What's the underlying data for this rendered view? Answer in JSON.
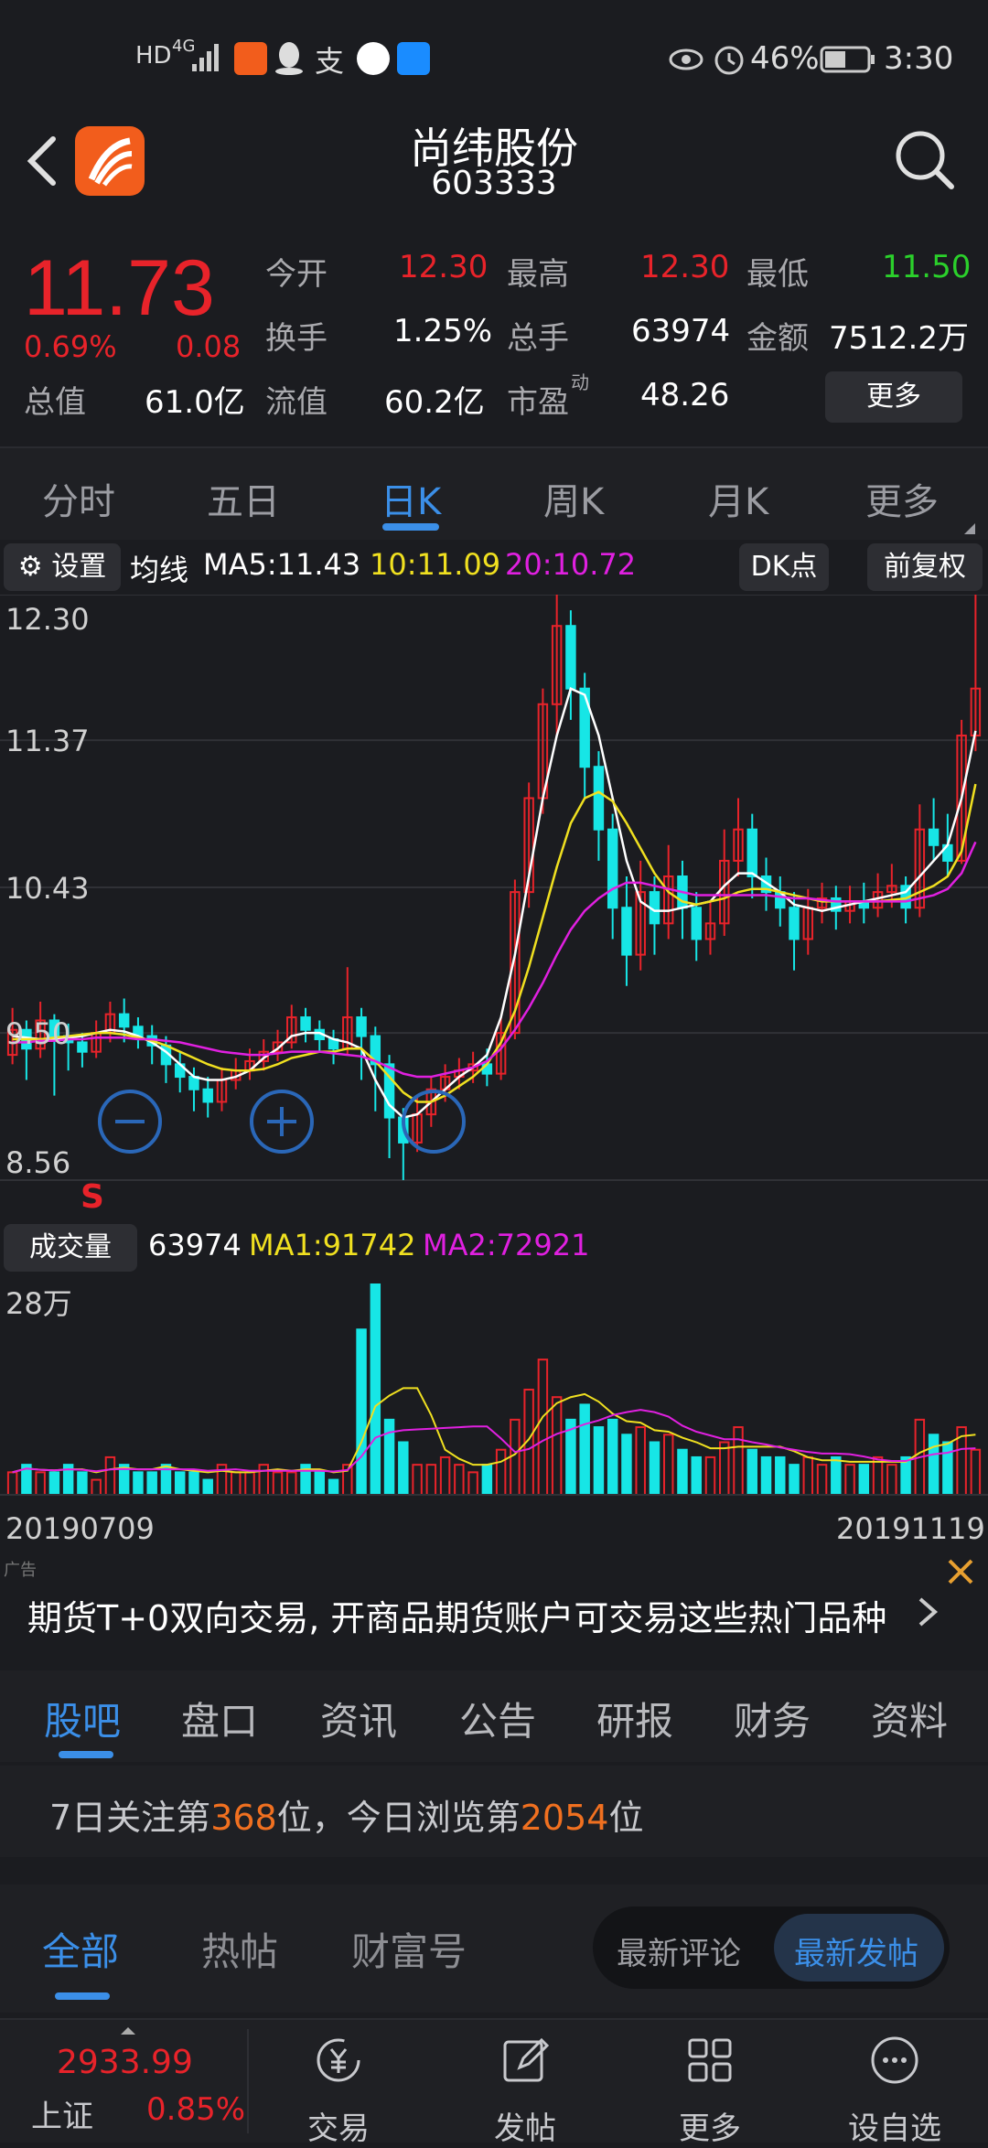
{
  "status_bar": {
    "left_indicators": [
      "HD",
      "4G"
    ],
    "battery": "46%",
    "time": "3:30"
  },
  "header": {
    "stock_name": "尚纬股份",
    "stock_code": "603333"
  },
  "quote": {
    "price": "11.73",
    "change_pct": "0.69%",
    "change": "0.08",
    "fields": [
      {
        "label": "今开",
        "value": "12.30",
        "color": "red"
      },
      {
        "label": "最高",
        "value": "12.30",
        "color": "red"
      },
      {
        "label": "最低",
        "value": "11.50",
        "color": "green"
      },
      {
        "label": "换手",
        "value": "1.25%",
        "color": "white"
      },
      {
        "label": "总手",
        "value": "63974",
        "color": "white"
      },
      {
        "label": "金额",
        "value": "7512.2万",
        "color": "white"
      },
      {
        "label": "总值",
        "value": "61.0亿",
        "color": "white"
      },
      {
        "label": "流值",
        "value": "60.2亿",
        "color": "white"
      },
      {
        "label": "市盈",
        "value": "48.26",
        "color": "white"
      }
    ],
    "pe_superscript": "动",
    "more_label": "更多"
  },
  "period_tabs": [
    {
      "label": "分时",
      "active": false
    },
    {
      "label": "五日",
      "active": false
    },
    {
      "label": "日K",
      "active": true
    },
    {
      "label": "周K",
      "active": false
    },
    {
      "label": "月K",
      "active": false
    },
    {
      "label": "更多",
      "active": false
    }
  ],
  "ma_row": {
    "settings_label": "设置",
    "ma_title": "均线",
    "ma5": "MA5:11.43",
    "ma10": "10:11.09",
    "ma20": "20:10.72",
    "dk_label": "DK点",
    "adjust_label": "前复权"
  },
  "chart_data": {
    "type": "candlestick",
    "y_ticks": [
      "12.30",
      "11.37",
      "10.43",
      "9.50",
      "8.56"
    ],
    "ylim": [
      8.56,
      12.3
    ],
    "date_start": "20190709",
    "date_end": "20191119",
    "signal_marker": "S",
    "colors": {
      "up": "#e8232a",
      "down": "#17e6e6",
      "ma5": "#ffffff",
      "ma10": "#f0e020",
      "ma20": "#e020e0"
    },
    "candles": [
      [
        9.36,
        9.52,
        9.66,
        9.3
      ],
      [
        9.52,
        9.4,
        9.58,
        9.2
      ],
      [
        9.4,
        9.58,
        9.7,
        9.34
      ],
      [
        9.58,
        9.48,
        9.62,
        9.1
      ],
      [
        9.48,
        9.44,
        9.56,
        9.26
      ],
      [
        9.44,
        9.38,
        9.5,
        9.28
      ],
      [
        9.38,
        9.5,
        9.58,
        9.34
      ],
      [
        9.5,
        9.62,
        9.7,
        9.44
      ],
      [
        9.62,
        9.54,
        9.72,
        9.44
      ],
      [
        9.54,
        9.48,
        9.6,
        9.4
      ],
      [
        9.48,
        9.42,
        9.55,
        9.3
      ],
      [
        9.42,
        9.3,
        9.48,
        9.18
      ],
      [
        9.3,
        9.22,
        9.38,
        9.12
      ],
      [
        9.22,
        9.14,
        9.28,
        9.0
      ],
      [
        9.14,
        9.06,
        9.22,
        8.96
      ],
      [
        9.06,
        9.2,
        9.28,
        9.0
      ],
      [
        9.2,
        9.26,
        9.34,
        9.14
      ],
      [
        9.26,
        9.32,
        9.4,
        9.2
      ],
      [
        9.32,
        9.38,
        9.46,
        9.26
      ],
      [
        9.38,
        9.44,
        9.52,
        9.32
      ],
      [
        9.44,
        9.6,
        9.68,
        9.4
      ],
      [
        9.6,
        9.52,
        9.66,
        9.44
      ],
      [
        9.52,
        9.46,
        9.58,
        9.38
      ],
      [
        9.46,
        9.4,
        9.52,
        9.3
      ],
      [
        9.4,
        9.6,
        9.92,
        9.36
      ],
      [
        9.6,
        9.48,
        9.66,
        9.2
      ],
      [
        9.48,
        9.3,
        9.54,
        9.0
      ],
      [
        9.3,
        8.96,
        9.36,
        8.7
      ],
      [
        8.96,
        8.8,
        9.02,
        8.56
      ],
      [
        8.8,
        8.98,
        9.1,
        8.74
      ],
      [
        8.98,
        9.14,
        9.22,
        8.9
      ],
      [
        9.14,
        9.22,
        9.3,
        9.06
      ],
      [
        9.22,
        9.26,
        9.34,
        9.14
      ],
      [
        9.26,
        9.3,
        9.38,
        9.18
      ],
      [
        9.3,
        9.24,
        9.4,
        9.16
      ],
      [
        9.24,
        9.5,
        9.6,
        9.2
      ],
      [
        9.5,
        10.4,
        10.48,
        9.46
      ],
      [
        10.4,
        11.0,
        11.1,
        10.3
      ],
      [
        11.0,
        11.6,
        11.7,
        10.9
      ],
      [
        11.6,
        12.1,
        12.3,
        11.4
      ],
      [
        12.1,
        11.7,
        12.2,
        11.5
      ],
      [
        11.7,
        11.2,
        11.8,
        11.0
      ],
      [
        11.2,
        10.8,
        11.3,
        10.6
      ],
      [
        10.8,
        10.3,
        10.9,
        10.1
      ],
      [
        10.3,
        10.0,
        10.5,
        9.8
      ],
      [
        10.0,
        10.4,
        10.6,
        9.9
      ],
      [
        10.4,
        10.2,
        10.5,
        10.0
      ],
      [
        10.2,
        10.5,
        10.7,
        10.1
      ],
      [
        10.5,
        10.3,
        10.6,
        10.1
      ],
      [
        10.3,
        10.1,
        10.4,
        9.96
      ],
      [
        10.1,
        10.2,
        10.34,
        10.0
      ],
      [
        10.2,
        10.6,
        10.8,
        10.12
      ],
      [
        10.6,
        10.8,
        11.0,
        10.5
      ],
      [
        10.8,
        10.5,
        10.9,
        10.36
      ],
      [
        10.5,
        10.4,
        10.62,
        10.28
      ],
      [
        10.4,
        10.3,
        10.5,
        10.18
      ],
      [
        10.3,
        10.1,
        10.4,
        9.9
      ],
      [
        10.1,
        10.3,
        10.42,
        10.0
      ],
      [
        10.3,
        10.36,
        10.46,
        10.2
      ],
      [
        10.36,
        10.28,
        10.44,
        10.16
      ],
      [
        10.28,
        10.34,
        10.44,
        10.2
      ],
      [
        10.34,
        10.3,
        10.46,
        10.2
      ],
      [
        10.3,
        10.4,
        10.52,
        10.24
      ],
      [
        10.4,
        10.44,
        10.58,
        10.3
      ],
      [
        10.44,
        10.3,
        10.5,
        10.2
      ],
      [
        10.3,
        10.8,
        10.96,
        10.24
      ],
      [
        10.8,
        10.7,
        11.0,
        10.6
      ],
      [
        10.7,
        10.6,
        10.9,
        10.5
      ],
      [
        10.6,
        11.4,
        11.5,
        10.58
      ],
      [
        11.4,
        11.7,
        12.3,
        11.3
      ]
    ],
    "ma5": [
      9.48,
      9.47,
      9.46,
      9.46,
      9.47,
      9.48,
      9.5,
      9.52,
      9.51,
      9.48,
      9.44,
      9.38,
      9.3,
      9.22,
      9.2,
      9.2,
      9.22,
      9.26,
      9.34,
      9.4,
      9.48,
      9.5,
      9.5,
      9.46,
      9.44,
      9.4,
      9.2,
      9.04,
      8.96,
      8.98,
      9.06,
      9.14,
      9.22,
      9.28,
      9.36,
      9.6,
      10.0,
      10.5,
      11.0,
      11.4,
      11.7,
      11.66,
      11.4,
      11.0,
      10.6,
      10.34,
      10.28,
      10.28,
      10.3,
      10.32,
      10.34,
      10.44,
      10.52,
      10.52,
      10.46,
      10.4,
      10.32,
      10.3,
      10.28,
      10.3,
      10.32,
      10.34,
      10.36,
      10.38,
      10.4,
      10.5,
      10.6,
      10.7,
      11.0,
      11.43
    ],
    "ma10": [
      9.46,
      9.46,
      9.46,
      9.47,
      9.48,
      9.49,
      9.5,
      9.5,
      9.49,
      9.47,
      9.45,
      9.42,
      9.38,
      9.34,
      9.3,
      9.27,
      9.26,
      9.26,
      9.27,
      9.3,
      9.34,
      9.36,
      9.38,
      9.38,
      9.4,
      9.4,
      9.32,
      9.22,
      9.12,
      9.06,
      9.06,
      9.1,
      9.16,
      9.22,
      9.3,
      9.44,
      9.64,
      9.92,
      10.24,
      10.56,
      10.84,
      11.0,
      11.04,
      10.98,
      10.84,
      10.68,
      10.52,
      10.4,
      10.34,
      10.32,
      10.34,
      10.36,
      10.4,
      10.42,
      10.42,
      10.4,
      10.38,
      10.36,
      10.34,
      10.34,
      10.34,
      10.34,
      10.34,
      10.35,
      10.36,
      10.4,
      10.44,
      10.5,
      10.66,
      11.09
    ],
    "ma20": [
      9.44,
      9.44,
      9.45,
      9.45,
      9.46,
      9.46,
      9.47,
      9.47,
      9.47,
      9.46,
      9.46,
      9.45,
      9.44,
      9.42,
      9.4,
      9.38,
      9.37,
      9.36,
      9.36,
      9.37,
      9.38,
      9.38,
      9.38,
      9.37,
      9.36,
      9.35,
      9.32,
      9.28,
      9.24,
      9.22,
      9.22,
      9.24,
      9.26,
      9.28,
      9.32,
      9.4,
      9.52,
      9.66,
      9.82,
      10.0,
      10.16,
      10.28,
      10.36,
      10.42,
      10.46,
      10.46,
      10.44,
      10.42,
      10.4,
      10.38,
      10.38,
      10.38,
      10.38,
      10.38,
      10.38,
      10.37,
      10.36,
      10.36,
      10.35,
      10.34,
      10.34,
      10.34,
      10.34,
      10.34,
      10.34,
      10.36,
      10.38,
      10.42,
      10.52,
      10.72
    ]
  },
  "volume": {
    "label": "成交量",
    "current": "63974",
    "ma1": "MA1:91742",
    "ma2": "MA2:72921",
    "top_tick": "28万",
    "values": [
      3,
      4,
      3,
      3,
      4,
      3,
      2,
      5,
      4,
      3,
      3,
      4,
      3,
      3,
      2,
      4,
      3,
      3,
      4,
      3,
      3,
      4,
      3,
      2,
      4,
      22,
      28,
      10,
      7,
      4,
      4,
      5,
      4,
      3,
      4,
      6,
      10,
      14,
      18,
      13,
      10,
      12,
      9,
      10,
      8,
      9,
      7,
      8,
      6,
      5,
      5,
      7,
      9,
      6,
      5,
      5,
      4,
      5,
      4,
      5,
      4,
      4,
      5,
      4,
      5,
      10,
      8,
      7,
      9,
      6
    ]
  },
  "ad": {
    "tag": "广告",
    "text": "期货T+0双向交易, 开商品期货账户可交易这些热门品种"
  },
  "info_tabs": [
    {
      "label": "股吧",
      "active": true
    },
    {
      "label": "盘口",
      "active": false
    },
    {
      "label": "资讯",
      "active": false
    },
    {
      "label": "公告",
      "active": false
    },
    {
      "label": "研报",
      "active": false
    },
    {
      "label": "财务",
      "active": false
    },
    {
      "label": "资料",
      "active": false
    }
  ],
  "rank": {
    "prefix": "7日关注第",
    "follow_rank": "368",
    "mid": "位，今日浏览第",
    "view_rank": "2054",
    "suffix": "位"
  },
  "filter_tabs": {
    "all": "全部",
    "hot": "热帖",
    "fortune": "财富号",
    "latest_comment": "最新评论",
    "latest_post": "最新发帖"
  },
  "bottom_nav": {
    "index_value": "2933.99",
    "index_name": "上证",
    "index_change": "0.85%",
    "items": [
      "交易",
      "发帖",
      "更多",
      "设自选"
    ]
  }
}
